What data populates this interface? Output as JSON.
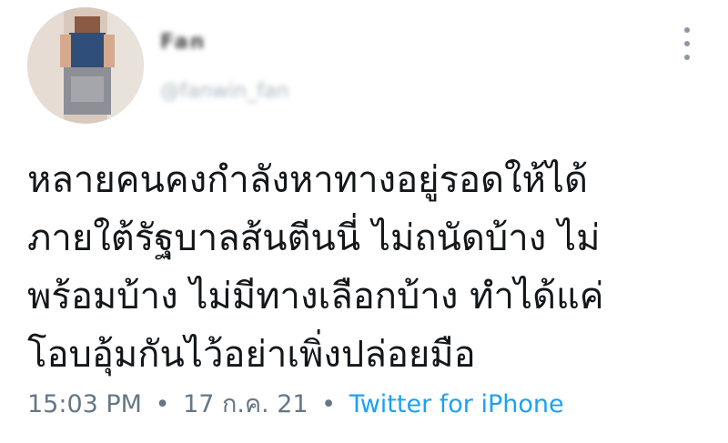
{
  "header": {
    "display_name": "Fan",
    "handle": "@fanwin_fan",
    "more_icon": "more-vertical-icon"
  },
  "tweet": {
    "lines": [
      "หลายคนคงกำลังหาทางอยู่รอดให้ได้",
      "ภายใต้รัฐบาลส้นตีนนี่ ไม่ถนัดบ้าง ไม่",
      "พร้อมบ้าง ไม่มีทางเลือกบ้าง ทำได้แค่",
      "โอบอุ้มกันไว้อย่าเพิ่งปล่อยมือ"
    ]
  },
  "meta": {
    "time": "15:03 PM",
    "separator": "•",
    "date": "17 ก.ค. 21",
    "source": "Twitter for iPhone"
  },
  "colors": {
    "text": "#14171a",
    "meta": "#657786",
    "link": "#1da1f2"
  }
}
